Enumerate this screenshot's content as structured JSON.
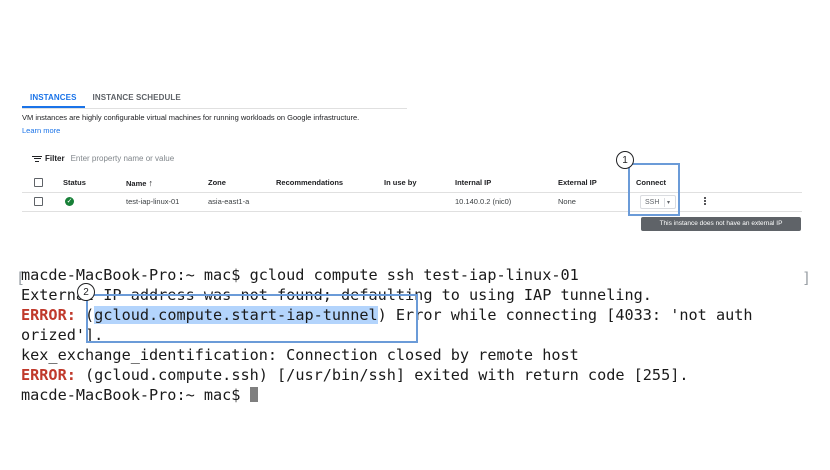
{
  "console": {
    "tabs": [
      {
        "label": "INSTANCES",
        "active": true
      },
      {
        "label": "INSTANCE SCHEDULE",
        "active": false
      }
    ],
    "description": "VM instances are highly configurable virtual machines for running workloads on Google infrastructure.",
    "learn_more": "Learn more",
    "filter": {
      "label": "Filter",
      "placeholder": "Enter property name or value"
    },
    "columns": [
      "Status",
      "Name",
      "Zone",
      "Recommendations",
      "In use by",
      "Internal IP",
      "External IP",
      "Connect"
    ],
    "sort_arrow": "↑",
    "rows": [
      {
        "status_icon": "check-circle-icon",
        "name": "test-iap-linux-01",
        "zone": "asia-east1-a",
        "recommendations": "",
        "in_use_by": "",
        "internal_ip": "10.140.0.2 (nic0)",
        "external_ip": "None",
        "connect": "SSH"
      }
    ],
    "tooltip": "This instance does not have an external IP"
  },
  "callouts": {
    "one": "1",
    "two": "2"
  },
  "terminal": {
    "line1": "macde-MacBook-Pro:~ mac$ gcloud compute ssh test-iap-linux-01",
    "line2": "External IP address was not found; defaulting to using IAP tunneling.",
    "line3_err": "ERROR:",
    "line3_pre": " (",
    "line3_hl": "gcloud.compute.start-iap-tunnel",
    "line3_post": ") Error while connecting [4033: 'not auth",
    "line4": "orized'].",
    "line5": "kex_exchange_identification: Connection closed by remote host",
    "line6_err": "ERROR:",
    "line6_rest": " (gcloud.compute.ssh) [/usr/bin/ssh] exited with return code [255].",
    "line7": "macde-MacBook-Pro:~ mac$ "
  },
  "colors": {
    "accent": "#1a73e8",
    "callout": "#6b9bd8",
    "error": "#c0392b",
    "highlight": "#b3d4fc",
    "status_ok": "#188038"
  }
}
